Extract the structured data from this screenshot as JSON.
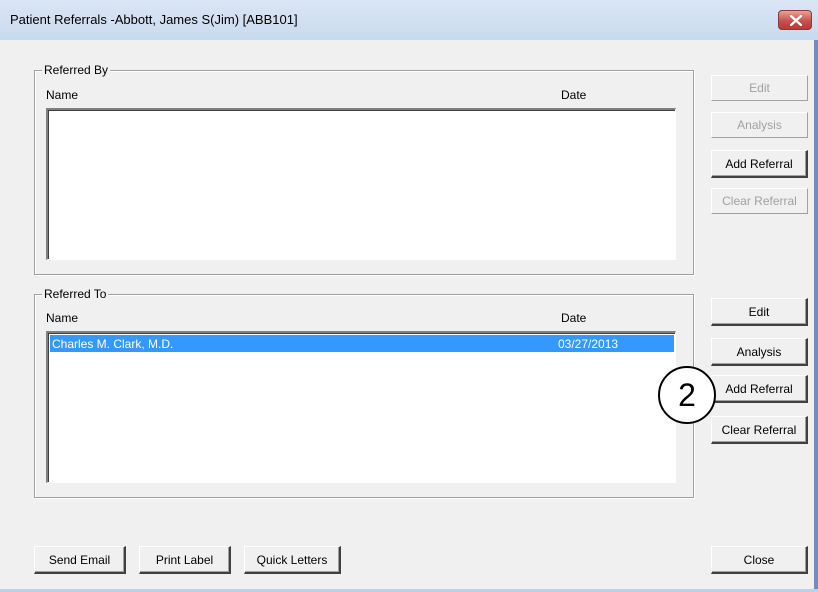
{
  "window": {
    "title": "Patient Referrals -Abbott, James S(Jim) [ABB101]",
    "close_icon": "close-icon"
  },
  "referred_by": {
    "legend": "Referred By",
    "col_name": "Name",
    "col_date": "Date",
    "rows": [],
    "buttons": {
      "edit": "Edit",
      "analysis": "Analysis",
      "add_referral": "Add Referral",
      "clear_referral": "Clear Referral"
    }
  },
  "referred_to": {
    "legend": "Referred To",
    "col_name": "Name",
    "col_date": "Date",
    "rows": [
      {
        "name": "Charles M. Clark, M.D.",
        "date": "03/27/2013",
        "selected": true
      }
    ],
    "buttons": {
      "edit": "Edit",
      "analysis": "Analysis",
      "add_referral": "Add Referral",
      "clear_referral": "Clear Referral"
    }
  },
  "footer": {
    "send_email": "Send Email",
    "print_label": "Print Label",
    "quick_letters": "Quick Letters",
    "close": "Close"
  },
  "callout": {
    "number": "2"
  },
  "colors": {
    "selection": "#3399ff",
    "disabled_text": "#a0a0a0"
  }
}
